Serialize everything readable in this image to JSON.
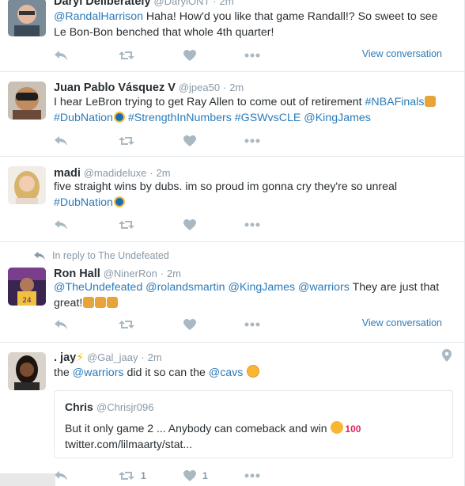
{
  "tweets": [
    {
      "name": "Daryl Deliberately",
      "handle": "@DarylONT",
      "sep": "·",
      "time": "2m",
      "text": [
        {
          "t": "@RandalHarrison",
          "link": true
        },
        {
          "t": " Haha! How'd you like that game Randall!? So sweet to see Le Bon-Bon benched that whole 4th quarter!",
          "link": false
        }
      ],
      "view_conversation": "View conversation"
    },
    {
      "name": "Juan Pablo Vásquez V",
      "handle": "@jpea50",
      "sep": "·",
      "time": "2m",
      "text_line1": "I hear LeBron trying to get Ray Allen to come out of retirement ",
      "hashtag_nbafinals": "#NBAFinals",
      "hashtag_dubnation": "#DubNation",
      "hashtag_strength": "#StrengthInNumbers",
      "hashtag_gswvscle": "#GSWvsCLE",
      "mention_kingjames": "@KingJames"
    },
    {
      "name": "madi",
      "handle": "@madideluxe",
      "sep": "·",
      "time": "2m",
      "text_line1": "five straight wins by dubs. im so proud im gonna cry they're so unreal",
      "hashtag_dubnation": "#DubNation"
    },
    {
      "reply_context": "In reply to The Undefeated",
      "name": "Ron Hall",
      "handle": "@NinerRon",
      "sep": "·",
      "time": "2m",
      "mention_undefeated": "@TheUndefeated",
      "mention_rolandsmartin": "@rolandsmartin",
      "mention_kingjames": "@KingJames",
      "mention_warriors": "@warriors",
      "text_rest": " They are just that great!",
      "view_conversation": "View conversation"
    },
    {
      "name": ". jay",
      "handle": "@Gal_jaay",
      "sep": "·",
      "time": "2m",
      "text_the": "the ",
      "mention_warriors": "@warriors",
      "text_mid": " did it so can the ",
      "mention_cavs": "@cavs",
      "quote": {
        "name": "Chris",
        "handle": "@Chrisjr096",
        "text_line1": "But it only game 2 ... Anybody can comeback and win",
        "text_line2": "twitter.com/lilmaarty/stat..."
      },
      "retweet_count": "1",
      "like_count": "1"
    }
  ],
  "icons": [
    "reply-icon",
    "retweet-icon",
    "like-icon",
    "more-icon",
    "location-pin-icon"
  ],
  "colors": {
    "link": "#2b7bb9",
    "muted": "#8899a6",
    "text": "#292f33",
    "border": "#e1e8ed"
  }
}
